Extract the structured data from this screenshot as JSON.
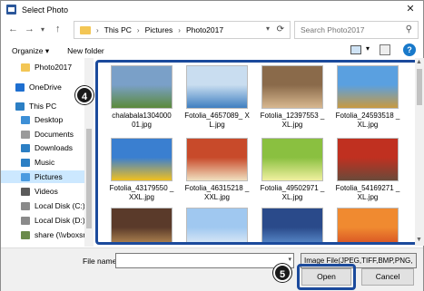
{
  "window": {
    "title": "Select Photo",
    "close_glyph": "✕"
  },
  "nav": {
    "back": "←",
    "forward": "→",
    "recent": "▾",
    "up": "↑",
    "breadcrumbs": [
      "This PC",
      "Pictures",
      "Photo2017"
    ],
    "crumb_separator": "›",
    "search_placeholder": "Search Photo2017"
  },
  "toolbar": {
    "organize": "Organize ▾",
    "new_folder": "New folder",
    "help": "?"
  },
  "sidebar": {
    "items": [
      {
        "label": "Photo2017",
        "icon": "folder-icon",
        "color": "#f3c655",
        "selected": false
      },
      {
        "label": "OneDrive",
        "icon": "cloud-icon",
        "color": "#1e6fd0",
        "selected": false
      },
      {
        "label": "This PC",
        "icon": "pc-icon",
        "color": "#2c7fc4",
        "selected": false
      },
      {
        "label": "Desktop",
        "icon": "desktop-icon",
        "color": "#3d8fd6",
        "selected": false
      },
      {
        "label": "Documents",
        "icon": "documents-icon",
        "color": "#9a9a9a",
        "selected": false
      },
      {
        "label": "Downloads",
        "icon": "downloads-icon",
        "color": "#2c7fc4",
        "selected": false
      },
      {
        "label": "Music",
        "icon": "music-icon",
        "color": "#2c7fc4",
        "selected": false
      },
      {
        "label": "Pictures",
        "icon": "pictures-icon",
        "color": "#4b9be0",
        "selected": true
      },
      {
        "label": "Videos",
        "icon": "videos-icon",
        "color": "#5a5a5a",
        "selected": false
      },
      {
        "label": "Local Disk (C:)",
        "icon": "disk-icon",
        "color": "#8a8a8a",
        "selected": false
      },
      {
        "label": "Local Disk (D:)",
        "icon": "disk-icon",
        "color": "#8a8a8a",
        "selected": false
      },
      {
        "label": "share (\\\\vboxsrv",
        "icon": "network-drive-icon",
        "color": "#6a8a4a",
        "selected": false
      }
    ]
  },
  "files": [
    {
      "name": "chalabala1304000 01.jpg",
      "colors": [
        "#7aa0c8",
        "#5b8a3a"
      ]
    },
    {
      "name": "Fotolia_4657089_ XL.jpg",
      "colors": [
        "#c9ddf0",
        "#3f7fc0"
      ]
    },
    {
      "name": "Fotolia_12397553 _XL.jpg",
      "colors": [
        "#8a6a4a",
        "#d8b890"
      ]
    },
    {
      "name": "Fotolia_24593518 _XL.jpg",
      "colors": [
        "#5aa0e0",
        "#c89a40"
      ]
    },
    {
      "name": "Fotolia_43179550 _XXL.jpg",
      "colors": [
        "#3a7fd0",
        "#f0c020"
      ]
    },
    {
      "name": "Fotolia_46315218 _XXL.jpg",
      "colors": [
        "#c84a2a",
        "#f0e0c0"
      ]
    },
    {
      "name": "Fotolia_49502971 _XL.jpg",
      "colors": [
        "#8ac040",
        "#f0f0a0"
      ]
    },
    {
      "name": "Fotolia_54169271 _XL.jpg",
      "colors": [
        "#c03020",
        "#6a4a3a"
      ]
    },
    {
      "name": "",
      "colors": [
        "#5a3a2a",
        "#d0a060"
      ]
    },
    {
      "name": "",
      "colors": [
        "#a0c8f0",
        "#f0f4f8"
      ]
    },
    {
      "name": "",
      "colors": [
        "#2a4a8a",
        "#6aa0e0"
      ]
    },
    {
      "name": "",
      "colors": [
        "#f08a30",
        "#d04020"
      ]
    }
  ],
  "badges": {
    "grid": "4",
    "open": "5"
  },
  "bottom": {
    "filename_label": "File name:",
    "filename_value": "",
    "filetype": "Image File(JPEG,TIFF,BMP,PNG,",
    "open": "Open",
    "cancel": "Cancel"
  },
  "colors": {
    "highlight_border": "#1b4a9c",
    "selection": "#cce8ff"
  }
}
